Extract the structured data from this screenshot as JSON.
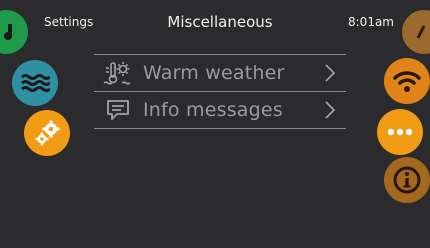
{
  "header": {
    "left_label": "Settings",
    "title": "Miscellaneous",
    "time": "8:01am"
  },
  "menu": {
    "items": [
      {
        "label": "Warm weather",
        "icon": "thermometer-sun-icon"
      },
      {
        "label": "Info messages",
        "icon": "message-icon"
      }
    ]
  },
  "colors": {
    "background": "#2b2b2d",
    "orange": "#f29b14",
    "teal": "#2f8fa3",
    "green": "#1f9a4a"
  },
  "icons": {
    "left": [
      "music-icon",
      "water-waves-icon",
      "gears-icon"
    ],
    "right": [
      "top-right-icon",
      "wifi-icon",
      "more-dots-icon",
      "info-icon"
    ]
  }
}
